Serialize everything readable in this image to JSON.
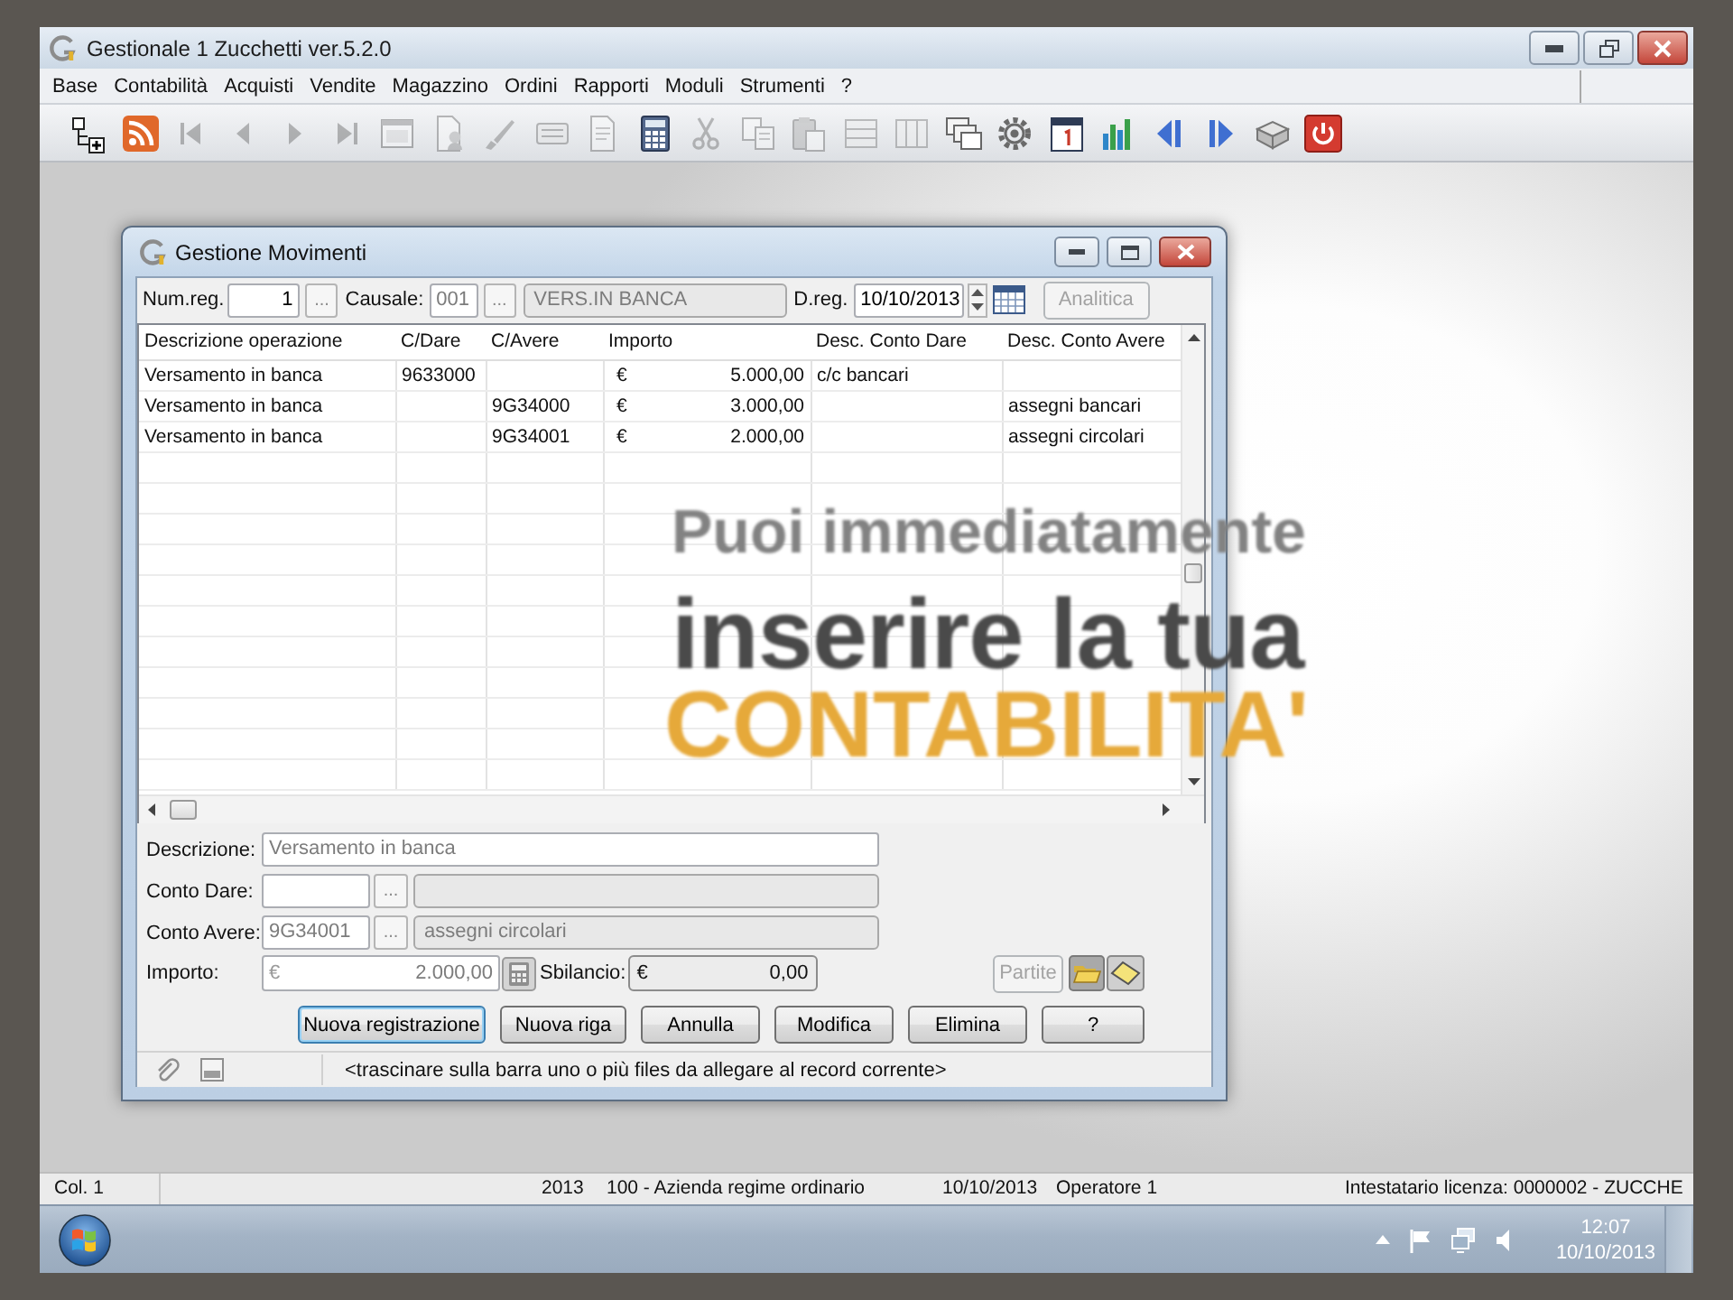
{
  "window": {
    "title": "Gestionale 1 Zucchetti ver.5.2.0"
  },
  "menu": [
    "Base",
    "Contabilità",
    "Acquisti",
    "Vendite",
    "Magazzino",
    "Ordini",
    "Rapporti",
    "Moduli",
    "Strumenti",
    "?"
  ],
  "toolbar": [
    {
      "kind": "tree",
      "disabled": false
    },
    {
      "kind": "feed",
      "disabled": false
    },
    {
      "kind": "first",
      "disabled": true
    },
    {
      "kind": "previous",
      "disabled": true
    },
    {
      "kind": "next",
      "disabled": true
    },
    {
      "kind": "last",
      "disabled": true
    },
    {
      "kind": "window",
      "disabled": true
    },
    {
      "kind": "document",
      "disabled": true
    },
    {
      "kind": "brush",
      "disabled": true
    },
    {
      "kind": "list",
      "disabled": true
    },
    {
      "kind": "page",
      "disabled": true
    },
    {
      "kind": "calculator",
      "disabled": false
    },
    {
      "kind": "scissors",
      "disabled": true
    },
    {
      "kind": "copy",
      "disabled": true
    },
    {
      "kind": "paste",
      "disabled": true
    },
    {
      "kind": "rows",
      "disabled": true
    },
    {
      "kind": "columns",
      "disabled": true
    },
    {
      "kind": "cascade",
      "disabled": false
    },
    {
      "kind": "gear",
      "disabled": false
    },
    {
      "kind": "calendar",
      "disabled": false
    },
    {
      "kind": "chart",
      "disabled": false
    },
    {
      "kind": "back",
      "disabled": false
    },
    {
      "kind": "forward",
      "disabled": false
    },
    {
      "kind": "box",
      "disabled": false
    },
    {
      "kind": "power",
      "disabled": false
    }
  ],
  "dialog": {
    "title": "Gestione Movimenti",
    "header": {
      "num_reg": {
        "label": "Num.reg.",
        "value": "1",
        "lookup": "...",
        "disabled": false
      },
      "causale": {
        "label": "Causale:",
        "code": "001",
        "lookup": "...",
        "description": "VERS.IN BANCA",
        "disabled": true
      },
      "d_reg": {
        "label": "D.reg.",
        "value": "10/10/2013",
        "disabled": false
      },
      "analitica": {
        "label": "Analitica",
        "disabled": true
      }
    },
    "table": {
      "columns": [
        "Descrizione operazione",
        "C/Dare",
        "C/Avere",
        "Importo",
        "Desc. Conto Dare",
        "Desc. Conto Avere"
      ],
      "rows": [
        {
          "descrizione": "Versamento in banca",
          "c_dare": "9633000",
          "currency": "€",
          "importo": "5.000,00",
          "desc_dare": "c/c bancari"
        },
        {
          "descrizione": "Versamento in banca",
          "c_avere": "9G34000",
          "currency": "€",
          "importo": "3.000,00",
          "desc_avere": "assegni bancari"
        },
        {
          "descrizione": "Versamento in banca",
          "c_avere": "9G34001",
          "currency": "€",
          "importo": "2.000,00",
          "desc_avere": "assegni circolari"
        }
      ]
    },
    "form": {
      "descrizione": {
        "label": "Descrizione:",
        "value": "Versamento in banca",
        "disabled": true
      },
      "conto_dare": {
        "label": "Conto Dare:",
        "lookup": "..."
      },
      "conto_avere": {
        "label": "Conto Avere:",
        "code": "9G34001",
        "lookup": "...",
        "description": "assegni circolari",
        "disabled": true
      },
      "importo": {
        "label": "Importo:",
        "currency": "€",
        "value": "2.000,00",
        "disabled": true
      },
      "sbilancio": {
        "label": "Sbilancio:",
        "currency": "€",
        "value": "0,00"
      },
      "partite": {
        "label": "Partite",
        "disabled": true
      }
    },
    "buttons": [
      {
        "label": "Nuova registrazione",
        "focused": true
      },
      {
        "label": "Nuova riga",
        "focused": false
      },
      {
        "label": "Annulla",
        "focused": false
      },
      {
        "label": "Modifica",
        "focused": false
      },
      {
        "label": "Elimina",
        "focused": false
      },
      {
        "label": "?",
        "focused": false
      }
    ],
    "attachment_hint": "<trascinare sulla barra uno o più files da allegare al record corrente>"
  },
  "status_bar": {
    "column": "Col. 1",
    "year": "2013",
    "company": "100 - Azienda regime ordinario",
    "date": "10/10/2013",
    "operator": "Operatore 1",
    "license": "Intestatario licenza: 0000002 - ZUCCHE"
  },
  "taskbar": {
    "time": "12:07",
    "date": "10/10/2013"
  },
  "caption": [
    {
      "text": "Puoi immediatamente",
      "kind": "intro"
    },
    {
      "text": "inserire la tua",
      "kind": "headline"
    },
    {
      "text": "CONTABILITA'",
      "kind": "highlight"
    }
  ]
}
